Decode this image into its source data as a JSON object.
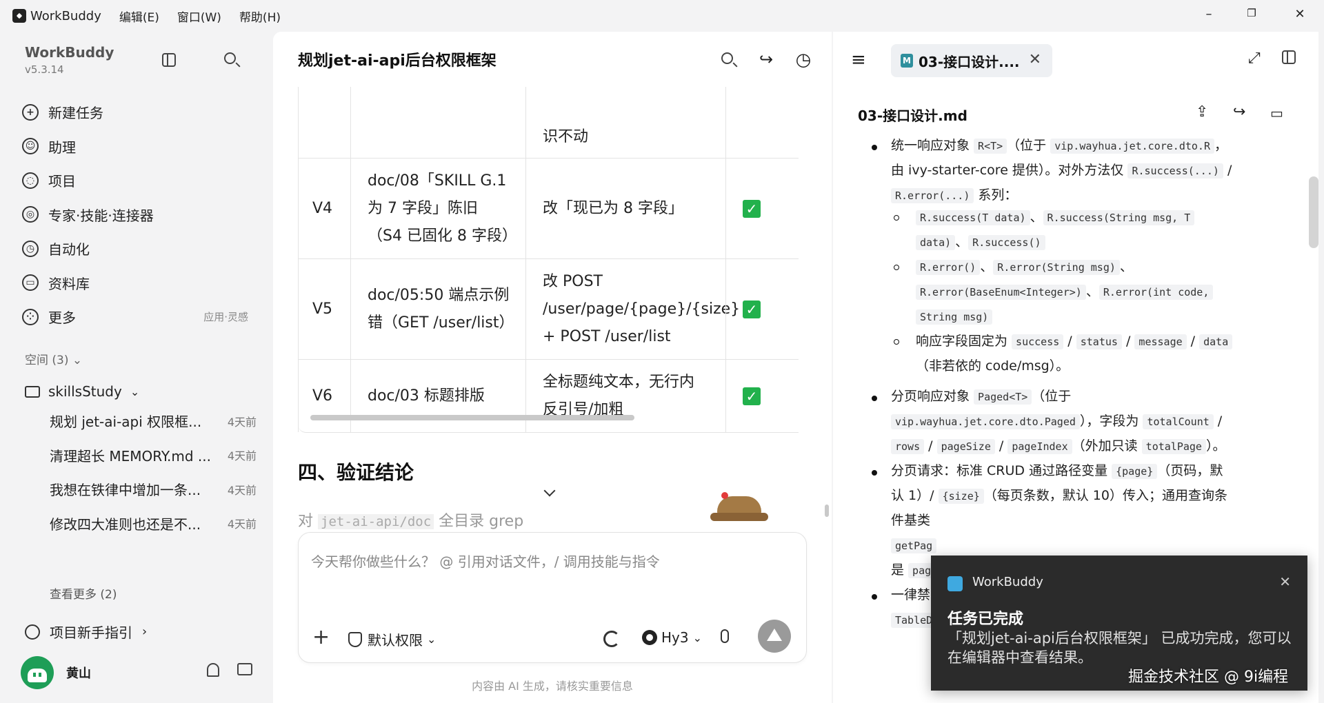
{
  "titlebar": {
    "app_name": "WorkBuddy",
    "menus": [
      "编辑(E)",
      "窗口(W)",
      "帮助(H)"
    ],
    "minimize": "–",
    "restore": "❐",
    "close": "✕"
  },
  "sidebar": {
    "brand_name": "WorkBuddy",
    "version": "v5.3.14",
    "nav": [
      {
        "label": "新建任务",
        "icon": "plus-circle-icon",
        "glyph": "+"
      },
      {
        "label": "助理",
        "icon": "assistant-icon",
        "glyph": "☺"
      },
      {
        "label": "项目",
        "icon": "project-icon",
        "glyph": "◌"
      },
      {
        "label": "专家·技能·连接器",
        "icon": "expert-icon",
        "glyph": "◎"
      },
      {
        "label": "自动化",
        "icon": "alarm-icon",
        "glyph": "◷"
      },
      {
        "label": "资料库",
        "icon": "book-icon",
        "glyph": "▭"
      },
      {
        "label": "更多",
        "icon": "grid-icon",
        "glyph": "⁘",
        "hint": "应用·灵感"
      }
    ],
    "spaces_label": "空间 (3)",
    "project_name": "skillsStudy",
    "tasks": [
      {
        "title": "规划 jet-ai-api 权限框...",
        "time": "4天前"
      },
      {
        "title": "清理超长 MEMORY.md ...",
        "time": "4天前"
      },
      {
        "title": "我想在铁律中增加一条...",
        "time": "4天前"
      },
      {
        "title": "修改四大准则也还是不...",
        "time": "4天前"
      }
    ],
    "see_more": "查看更多 (2)",
    "guide": "项目新手指引",
    "user_name": "黄山"
  },
  "chat": {
    "title": "规划jet-ai-api后台权限框架",
    "table_top_cell": "识不动",
    "rows": [
      {
        "id": "V4",
        "issue": [
          "doc/08「SKILL G.1",
          "为 7 字段」陈旧",
          "（S4 已固化 8 字段）"
        ],
        "fix": [
          "改「现已为 8 字段」"
        ],
        "done": "✓"
      },
      {
        "id": "V5",
        "issue": [
          "doc/05:50 端点示例",
          "错（GET /user/list）"
        ],
        "fix": [
          "改 POST",
          "/user/page/{page}/{size}",
          "+ POST /user/list"
        ],
        "done": "✓"
      },
      {
        "id": "V6",
        "issue": [
          "doc/03 标题排版"
        ],
        "fix": [
          "全标题纯文本，无行内",
          "反引号/加粗"
        ],
        "done": "✓"
      }
    ],
    "section_heading": "四、验证结论",
    "faded_prefix": "对 ",
    "faded_code": "jet-ai-api/doc",
    "faded_suffix": " 全目录 grep",
    "input_placeholder": "今天帮你做些什么？ @ 引用对话文件，/ 调用技能与指令",
    "permission_label": "默认权限",
    "model_label": "Hy3",
    "disclaimer": "内容由 AI 生成，请核实重要信息"
  },
  "doc": {
    "tab_label": "03-接口设计....",
    "file_name": "03-接口设计.md",
    "lines": {
      "b1a_t1": "统一响应对象 ",
      "b1a_c1": "R<T>",
      "b1a_t2": "（位于 ",
      "b1a_c2": "vip.wayhua.jet.core.dto.R",
      "b1a_t3": "，",
      "b1b_t1": "由 ivy-starter-core 提供）。对外方法仅 ",
      "b1b_c1": "R.success(...)",
      "b1b_t2": " /",
      "b1c_c1": "R.error(...)",
      "b1c_t1": " 系列：",
      "s1a_c1": "R.success(T data)",
      "s1a_t1": "、",
      "s1a_c2": "R.success(String msg, T",
      "s1b_c1": "data)",
      "s1b_t1": "、",
      "s1b_c2": "R.success()",
      "s2a_c1": "R.error()",
      "s2a_t1": "、",
      "s2a_c2": "R.error(String msg)",
      "s2a_t2": "、",
      "s2b_c1": "R.error(BaseEnum<Integer>)",
      "s2b_t1": "、",
      "s2b_c2": "R.error(int code,",
      "s2c_c1": "String msg)",
      "s3a_t1": "响应字段固定为 ",
      "s3a_c1": "success",
      "s3a_t2": " / ",
      "s3a_c2": "status",
      "s3a_t3": " / ",
      "s3a_c3": "message",
      "s3a_t4": " / ",
      "s3a_c4": "data",
      "s3b_t1": "（非若依的 code/msg）。",
      "b2a_t1": "分页响应对象 ",
      "b2a_c1": "Paged<T>",
      "b2a_t2": "（位于",
      "b2b_c1": "vip.wayhua.jet.core.dto.Paged",
      "b2b_t1": "），字段为 ",
      "b2b_c2": "totalCount",
      "b2b_t2": " /",
      "b2c_c1": "rows",
      "b2c_t1": " / ",
      "b2c_c2": "pageSize",
      "b2c_t2": " / ",
      "b2c_c3": "pageIndex",
      "b2c_t3": "（外加只读 ",
      "b2c_c4": "totalPage",
      "b2c_t4": "）。",
      "b3a_t1": "分页请求：标准 CRUD 通过路径变量 ",
      "b3a_c1": "{page}",
      "b3a_t2": "（页码，默",
      "b3b_t1": "认 1）/ ",
      "b3b_c1": "{size}",
      "b3b_t2": "（每页条数，默认 10）传入；通用查询条",
      "b3c_t1": "件基类",
      "b3d_c1": "getPag",
      "b3e_t1": "是 ",
      "b3e_c1": "pag",
      "b4a_t1": "一律禁",
      "b4b_c1": "TableD"
    }
  },
  "toast": {
    "app": "WorkBuddy",
    "title": "任务已完成",
    "message": "「规划jet-ai-api后台权限框架」 已成功完成，您可以在编辑器中查看结果。",
    "close": "✕"
  },
  "watermark": "掘金技术社区 @ 9i编程"
}
